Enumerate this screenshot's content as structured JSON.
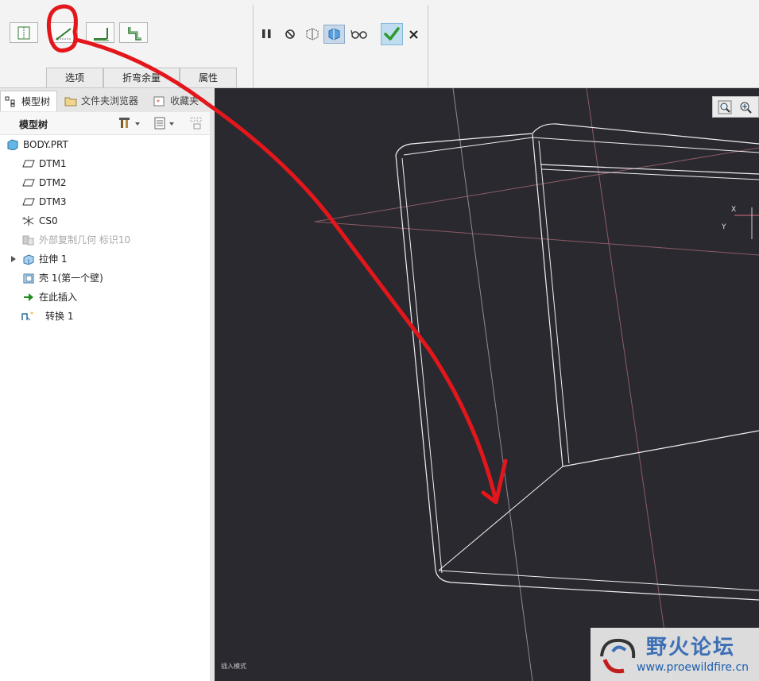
{
  "ribbon": {
    "tabs": [
      "选项",
      "折弯余量",
      "属性"
    ],
    "tool_icons": [
      "flat-wall-icon",
      "angled-wall-icon",
      "flanged-wall-icon",
      "offset-wall-icon"
    ],
    "right_icons": [
      "pause-icon",
      "no-preview-icon",
      "geometry-preview-icon",
      "verify-preview-icon",
      "glasses-icon",
      "confirm-check-icon",
      "cancel-x-icon"
    ]
  },
  "panel_tabs": [
    "模型树",
    "文件夹浏览器",
    "收藏夹"
  ],
  "tree": {
    "header": "模型树",
    "items": [
      {
        "label": "BODY.PRT",
        "icon": "part-icon"
      },
      {
        "label": "DTM1",
        "icon": "datum-plane-icon"
      },
      {
        "label": "DTM2",
        "icon": "datum-plane-icon"
      },
      {
        "label": "DTM3",
        "icon": "datum-plane-icon"
      },
      {
        "label": "CS0",
        "icon": "coordinate-system-icon"
      },
      {
        "label": "外部复制几何 标识10",
        "icon": "external-copy-geometry-icon"
      },
      {
        "label": "拉伸 1",
        "icon": "extrude-icon"
      },
      {
        "label": "壳 1(第一个壁)",
        "icon": "shell-icon"
      },
      {
        "label": "在此插入",
        "icon": "insert-here-arrow-icon"
      },
      {
        "label": "转换 1",
        "icon": "conversion-icon"
      }
    ]
  },
  "viewport": {
    "axis_labels": [
      "X",
      "Y"
    ],
    "status_text": "插入模式"
  },
  "watermark": {
    "title": "野火论坛",
    "url": "www.proewildfire.cn"
  },
  "colors": {
    "viewport_bg": "#2a2930",
    "annotation": "#e3171b",
    "check_green": "#2c9b2c"
  }
}
